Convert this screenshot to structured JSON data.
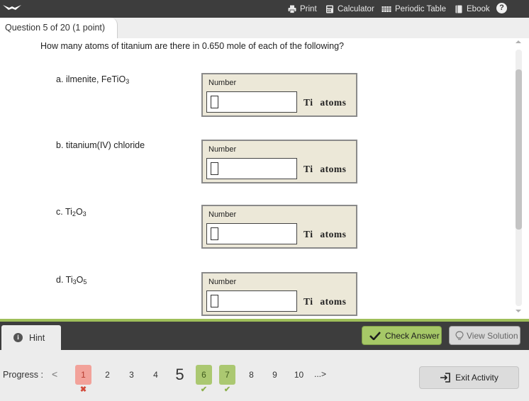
{
  "toolbar": {
    "logo_icon": "bird-logo-icon",
    "items": [
      {
        "label": "Print",
        "icon": "printer-icon"
      },
      {
        "label": "Calculator",
        "icon": "calculator-icon"
      },
      {
        "label": "Periodic Table",
        "icon": "periodic-table-icon"
      },
      {
        "label": "Ebook",
        "icon": "book-icon"
      }
    ],
    "help_label": "?"
  },
  "question_tab": {
    "label": "Question 5 of 20 (1 point)"
  },
  "question": {
    "stem": "How many atoms of titanium are there in 0.650 mole of each of the following?",
    "parts": [
      {
        "prefix": "a. ilmenite, FeTiO",
        "sub1": "3",
        "mid": "",
        "sub2": "",
        "input_label": "Number",
        "value": "",
        "unit": "Ti atoms"
      },
      {
        "prefix": "b. titanium(IV) chloride",
        "sub1": "",
        "mid": "",
        "sub2": "",
        "input_label": "Number",
        "value": "",
        "unit": "Ti atoms"
      },
      {
        "prefix": "c. Ti",
        "sub1": "2",
        "mid": "O",
        "sub2": "3",
        "input_label": "Number",
        "value": "",
        "unit": "Ti atoms"
      },
      {
        "prefix": "d. Ti",
        "sub1": "3",
        "mid": "O",
        "sub2": "5",
        "input_label": "Number",
        "value": "",
        "unit": "Ti atoms"
      }
    ]
  },
  "actions": {
    "hint_label": "Hint",
    "check_label": "Check Answer",
    "solution_label": "View Solution"
  },
  "progress": {
    "label": "Progress :",
    "prev": "<",
    "next": "...>",
    "items": [
      {
        "n": "1",
        "state": "wrong",
        "mark": "✖"
      },
      {
        "n": "2",
        "state": "none",
        "mark": ""
      },
      {
        "n": "3",
        "state": "none",
        "mark": ""
      },
      {
        "n": "4",
        "state": "none",
        "mark": ""
      },
      {
        "n": "5",
        "state": "current",
        "mark": ""
      },
      {
        "n": "6",
        "state": "correct",
        "mark": "✔"
      },
      {
        "n": "7",
        "state": "correct",
        "mark": "✔"
      },
      {
        "n": "8",
        "state": "none",
        "mark": ""
      },
      {
        "n": "9",
        "state": "none",
        "mark": ""
      },
      {
        "n": "10",
        "state": "none",
        "mark": ""
      }
    ]
  },
  "exit_label": "Exit Activity",
  "colors": {
    "toolbar_bg": "#3d3d3d",
    "accent_green": "#a6c867",
    "answer_box_bg": "#ece8d8",
    "wrong_red": "#f2a29a"
  }
}
